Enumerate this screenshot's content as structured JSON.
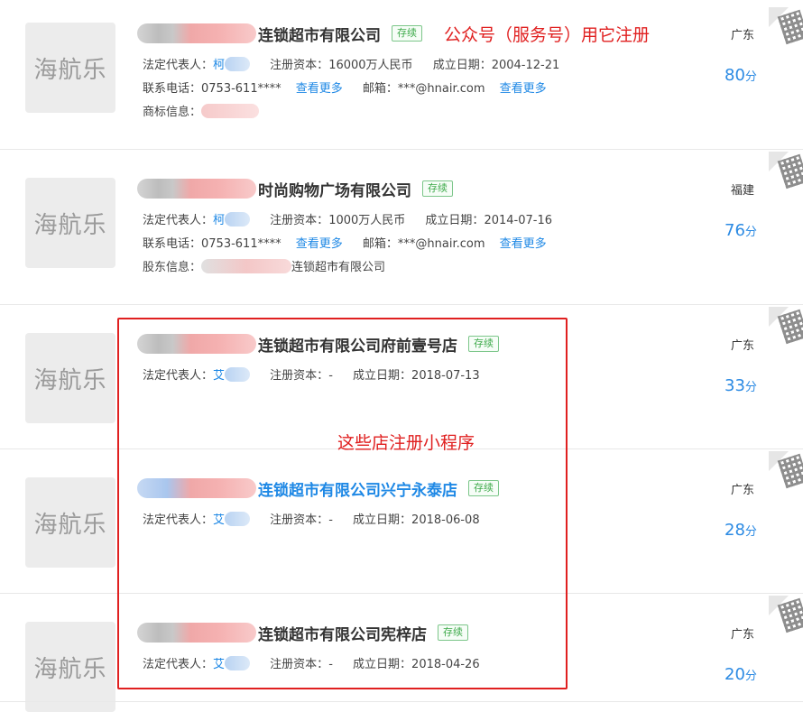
{
  "annotations": {
    "top_note": "公众号（服务号）用它注册",
    "box_note": "这些店注册小程序"
  },
  "labels": {
    "legal_rep": "法定代表人：",
    "capital": "注册资本：",
    "founded": "成立日期：",
    "phone": "联系电话：",
    "email": "邮箱：",
    "more": "查看更多",
    "trademark": "商标信息：",
    "shareholder": "股东信息：",
    "score_unit": "分"
  },
  "companies": [
    {
      "logo": "海航乐",
      "name": "连锁超市有限公司",
      "status": "存续",
      "legal_rep": "柯",
      "capital": "16000万人民币",
      "founded": "2004-12-21",
      "phone": "0753-611****",
      "email": "***@hnair.com",
      "extra": "",
      "region": "广东",
      "score": "80"
    },
    {
      "logo": "海航乐",
      "name": "时尚购物广场有限公司",
      "status": "存续",
      "legal_rep": "柯",
      "capital": "1000万人民币",
      "founded": "2014-07-16",
      "phone": "0753-611****",
      "email": "***@hnair.com",
      "extra": "连锁超市有限公司",
      "region": "福建",
      "score": "76"
    },
    {
      "logo": "海航乐",
      "name": "连锁超市有限公司府前壹号店",
      "status": "存续",
      "legal_rep": "艾",
      "capital": "-",
      "founded": "2018-07-13",
      "region": "广东",
      "score": "33"
    },
    {
      "logo": "海航乐",
      "name": "连锁超市有限公司兴宁永泰店",
      "status": "存续",
      "legal_rep": "艾",
      "capital": "-",
      "founded": "2018-06-08",
      "region": "广东",
      "score": "28"
    },
    {
      "logo": "海航乐",
      "name": "连锁超市有限公司宪梓店",
      "status": "存续",
      "legal_rep": "艾",
      "capital": "-",
      "founded": "2018-04-26",
      "region": "广东",
      "score": "20"
    }
  ]
}
